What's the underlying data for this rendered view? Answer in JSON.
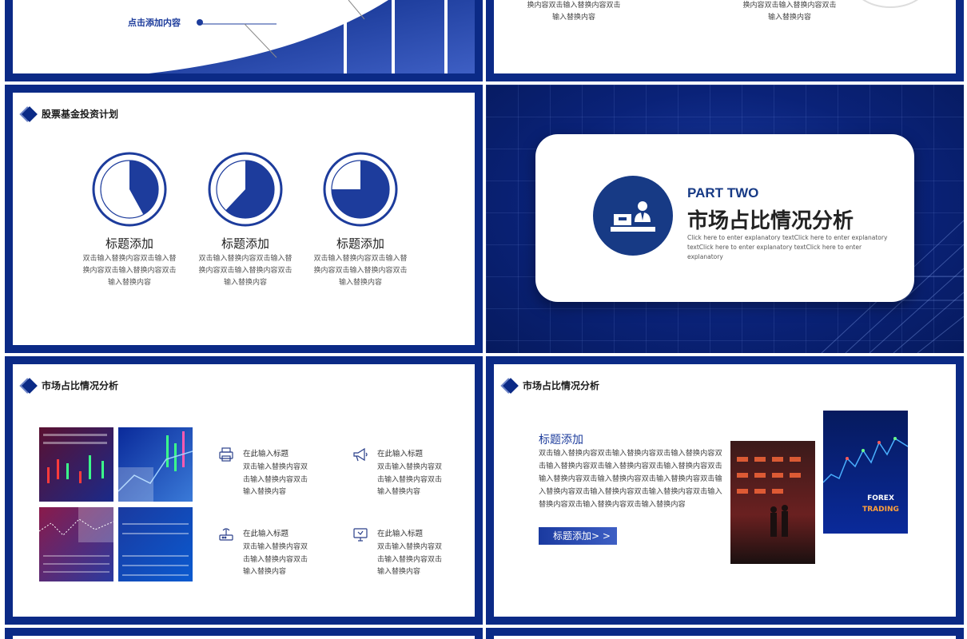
{
  "colors": {
    "brand": "#0b2a86",
    "accent": "#1d3c9c",
    "text": "#222222"
  },
  "slide1": {
    "label": "点击添加内容"
  },
  "slide2": {
    "left_text": [
      "换内容双击输入替换内容双击",
      "输入替换内容"
    ],
    "right_text": [
      "换内容双击输入替换内容双击",
      "输入替换内容"
    ]
  },
  "slide3": {
    "title": "股票基金投资计划",
    "items": [
      {
        "title": "标题添加",
        "lines": [
          "双击输入替换内容双击输入替",
          "换内容双击输入替换内容双击",
          "输入替换内容"
        ],
        "fraction": 0.42
      },
      {
        "title": "标题添加",
        "lines": [
          "双击输入替换内容双击输入替",
          "换内容双击输入替换内容双击",
          "输入替换内容"
        ],
        "fraction": 0.62
      },
      {
        "title": "标题添加",
        "lines": [
          "双击输入替换内容双击输入替",
          "换内容双击输入替换内容双击",
          "输入替换内容"
        ],
        "fraction": 0.75
      }
    ]
  },
  "slide4": {
    "part": "PART TWO",
    "title": "市场占比情况分析",
    "desc": "Click here to enter explanatory textClick here to enter explanatory textClick here to enter explanatory textClick here to enter explanatory",
    "icon": "presenter-icon"
  },
  "slide5": {
    "title": "市场占比情况分析",
    "features": [
      {
        "icon": "printer-icon",
        "title": "在此输入标题",
        "lines": [
          "双击输入替换内容双",
          "击输入替换内容双击",
          "输入替换内容"
        ]
      },
      {
        "icon": "megaphone-icon",
        "title": "在此输入标题",
        "lines": [
          "双击输入替换内容双",
          "击输入替换内容双击",
          "输入替换内容"
        ]
      },
      {
        "icon": "router-icon",
        "title": "在此输入标题",
        "lines": [
          "双击输入替换内容双",
          "击输入替换内容双击",
          "输入替换内容"
        ]
      },
      {
        "icon": "monitor-icon",
        "title": "在此输入标题",
        "lines": [
          "双击输入替换内容双",
          "击输入替换内容双击",
          "输入替换内容"
        ]
      }
    ]
  },
  "slide6": {
    "title": "市场占比情况分析",
    "heading": "标题添加",
    "paragraph": "双击输入替换内容双击输入替换内容双击输入替换内容双击输入替换内容双击输入替换内容双击输入替换内容双击输入替换内容双击输入替换内容双击输入替换内容双击输入替换内容双击输入替换内容双击输入替换内容双击输入替换内容双击输入替换内容双击输入替换内容",
    "button": "标题添加> >",
    "image2_text": [
      "FOREX",
      "TRADING"
    ]
  }
}
